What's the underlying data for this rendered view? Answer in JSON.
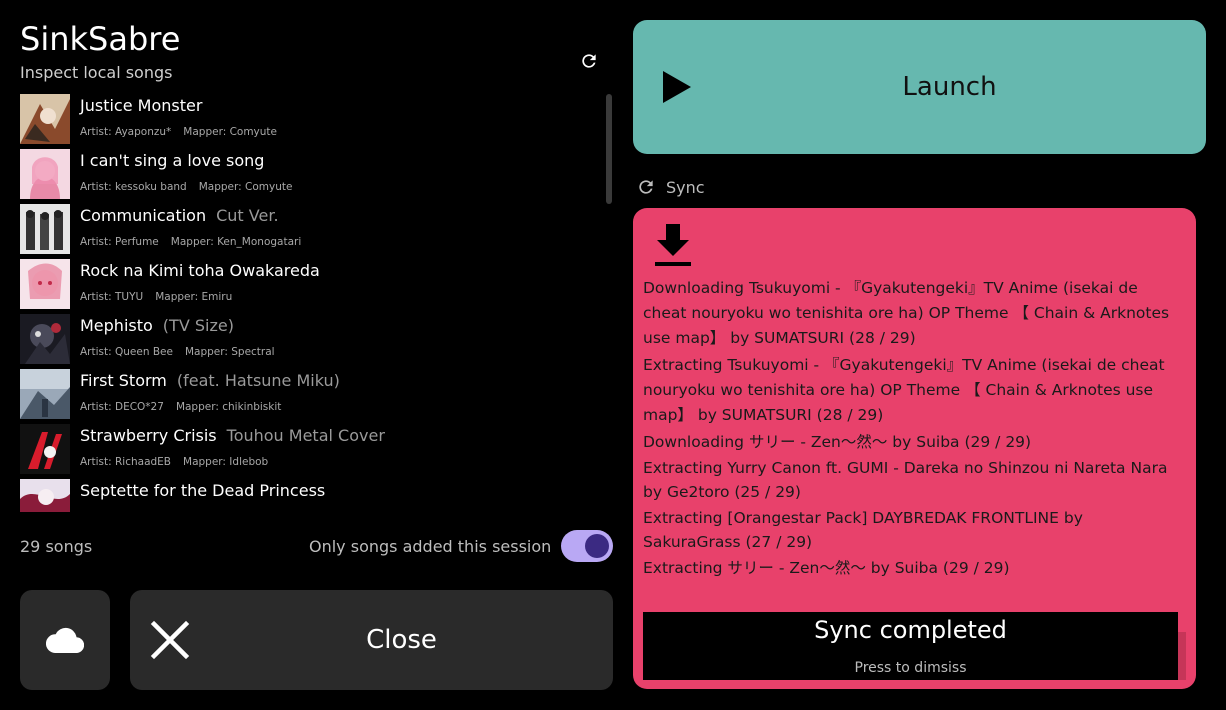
{
  "app": {
    "title": "SinkSabre",
    "subtitle": "Inspect local songs"
  },
  "songs": [
    {
      "title": "Justice Monster",
      "subtitle": "",
      "artist": "Artist: Ayaponzu*",
      "mapper": "Mapper: Comyute"
    },
    {
      "title": "I can't sing a love song",
      "subtitle": "",
      "artist": "Artist: kessoku band",
      "mapper": "Mapper: Comyute"
    },
    {
      "title": "Communication",
      "subtitle": "Cut Ver.",
      "artist": "Artist: Perfume",
      "mapper": "Mapper: Ken_Monogatari"
    },
    {
      "title": "Rock na Kimi toha Owakareda",
      "subtitle": "",
      "artist": "Artist: TUYU",
      "mapper": "Mapper: Emiru"
    },
    {
      "title": "Mephisto",
      "subtitle": "(TV Size)",
      "artist": "Artist: Queen Bee",
      "mapper": "Mapper: Spectral"
    },
    {
      "title": "First Storm",
      "subtitle": "(feat. Hatsune Miku)",
      "artist": "Artist: DECO*27",
      "mapper": "Mapper: chikinbiskit"
    },
    {
      "title": "Strawberry Crisis",
      "subtitle": "Touhou Metal Cover",
      "artist": "Artist: RichaadEB",
      "mapper": "Mapper: Idlebob"
    },
    {
      "title": "Septette for the Dead Princess",
      "subtitle": "",
      "artist": "",
      "mapper": ""
    }
  ],
  "footer": {
    "song_count": "29 songs",
    "toggle_label": "Only songs added this session",
    "toggle_on": true
  },
  "buttons": {
    "close_label": "Close",
    "launch_label": "Launch",
    "sync_label": "Sync"
  },
  "sync_log": [
    "Downloading Tsukuyomi - 『Gyakutengeki』TV Anime (isekai de cheat nouryoku wo tenishita ore ha) OP Theme 【 Chain & Arknotes use map】 by SUMATSURI (28 / 29)",
    "Extracting Tsukuyomi - 『Gyakutengeki』TV Anime (isekai de cheat nouryoku wo tenishita ore ha) OP Theme 【 Chain & Arknotes use map】 by SUMATSURI (28 / 29)",
    "Downloading サリー - Zen～然～ by Suiba (29 / 29)",
    "Extracting Yurry Canon ft. GUMI - Dareka no Shinzou ni Nareta Nara by Ge2toro (25 / 29)",
    "Extracting [Orangestar Pack] DAYBREDAK FRONTLINE by SakuraGrass (27 / 29)",
    "Extracting サリー - Zen～然～ by Suiba (29 / 29)"
  ],
  "toast": {
    "title": "Sync completed",
    "hint": "Press to dimsiss"
  },
  "colors": {
    "launch": "#66b8af",
    "sync_panel": "#e8416b",
    "toggle_track": "#b9a8f4",
    "toggle_knob": "#3b2a82",
    "button_bg": "#2a2a2a"
  }
}
